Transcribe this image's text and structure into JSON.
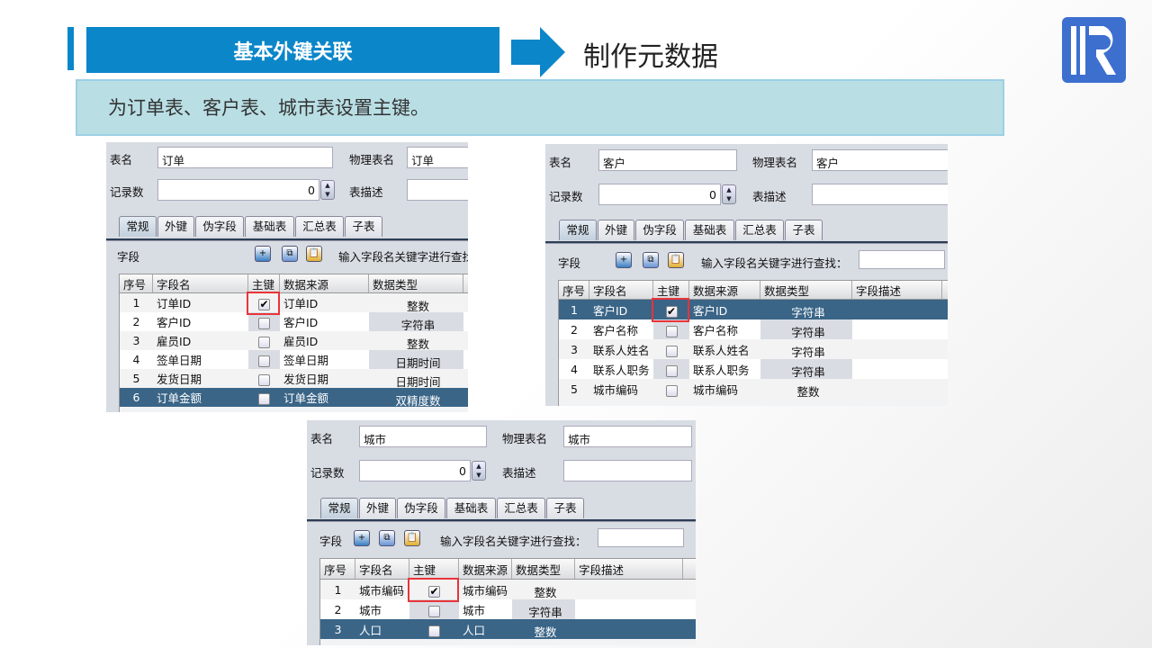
{
  "header": {
    "title": "基本外键关联",
    "subtitle": "制作元数据",
    "note": "为订单表、客户表、城市表设置主键。",
    "accent": "#0b86c9",
    "logo": "R"
  },
  "labels": {
    "table_name": "表名",
    "physical_name": "物理表名",
    "record_count": "记录数",
    "table_desc": "表描述",
    "fields": "字段"
  },
  "tabs": [
    "常规",
    "外键",
    "伪字段",
    "基础表",
    "汇总表",
    "子表"
  ],
  "columns": [
    "序号",
    "字段名",
    "主键",
    "数据来源",
    "数据类型",
    "字段描述"
  ],
  "panels": [
    {
      "table_name": "订单",
      "physical_name": "订单",
      "record_count": "0",
      "search_label": "输入字段名关键字进行查找",
      "columns_shown": 5,
      "rows": [
        {
          "no": "1",
          "name": "订单ID",
          "pk": true,
          "source": "订单ID",
          "type": "整数"
        },
        {
          "no": "2",
          "name": "客户ID",
          "pk": false,
          "source": "客户ID",
          "type": "字符串"
        },
        {
          "no": "3",
          "name": "雇员ID",
          "pk": false,
          "source": "雇员ID",
          "type": "整数"
        },
        {
          "no": "4",
          "name": "签单日期",
          "pk": false,
          "source": "签单日期",
          "type": "日期时间"
        },
        {
          "no": "5",
          "name": "发货日期",
          "pk": false,
          "source": "发货日期",
          "type": "日期时间"
        },
        {
          "no": "6",
          "name": "订单金额",
          "pk": false,
          "source": "订单金额",
          "type": "双精度数",
          "selected": true
        }
      ]
    },
    {
      "table_name": "客户",
      "physical_name": "客户",
      "record_count": "0",
      "search_label": "输入字段名关键字进行查找：",
      "columns_shown": 6,
      "rows": [
        {
          "no": "1",
          "name": "客户ID",
          "pk": true,
          "source": "客户ID",
          "type": "字符串",
          "selected": true
        },
        {
          "no": "2",
          "name": "客户名称",
          "pk": false,
          "source": "客户名称",
          "type": "字符串"
        },
        {
          "no": "3",
          "name": "联系人姓名",
          "pk": false,
          "source": "联系人姓名",
          "type": "字符串"
        },
        {
          "no": "4",
          "name": "联系人职务",
          "pk": false,
          "source": "联系人职务",
          "type": "字符串"
        },
        {
          "no": "5",
          "name": "城市编码",
          "pk": false,
          "source": "城市编码",
          "type": "整数"
        }
      ]
    },
    {
      "table_name": "城市",
      "physical_name": "城市",
      "record_count": "0",
      "search_label": "输入字段名关键字进行查找：",
      "columns_shown": 6,
      "rows": [
        {
          "no": "1",
          "name": "城市编码",
          "pk": true,
          "source": "城市编码",
          "type": "整数"
        },
        {
          "no": "2",
          "name": "城市",
          "pk": false,
          "source": "城市",
          "type": "字符串"
        },
        {
          "no": "3",
          "name": "人口",
          "pk": false,
          "source": "人口",
          "type": "整数",
          "selected": true
        }
      ]
    }
  ]
}
